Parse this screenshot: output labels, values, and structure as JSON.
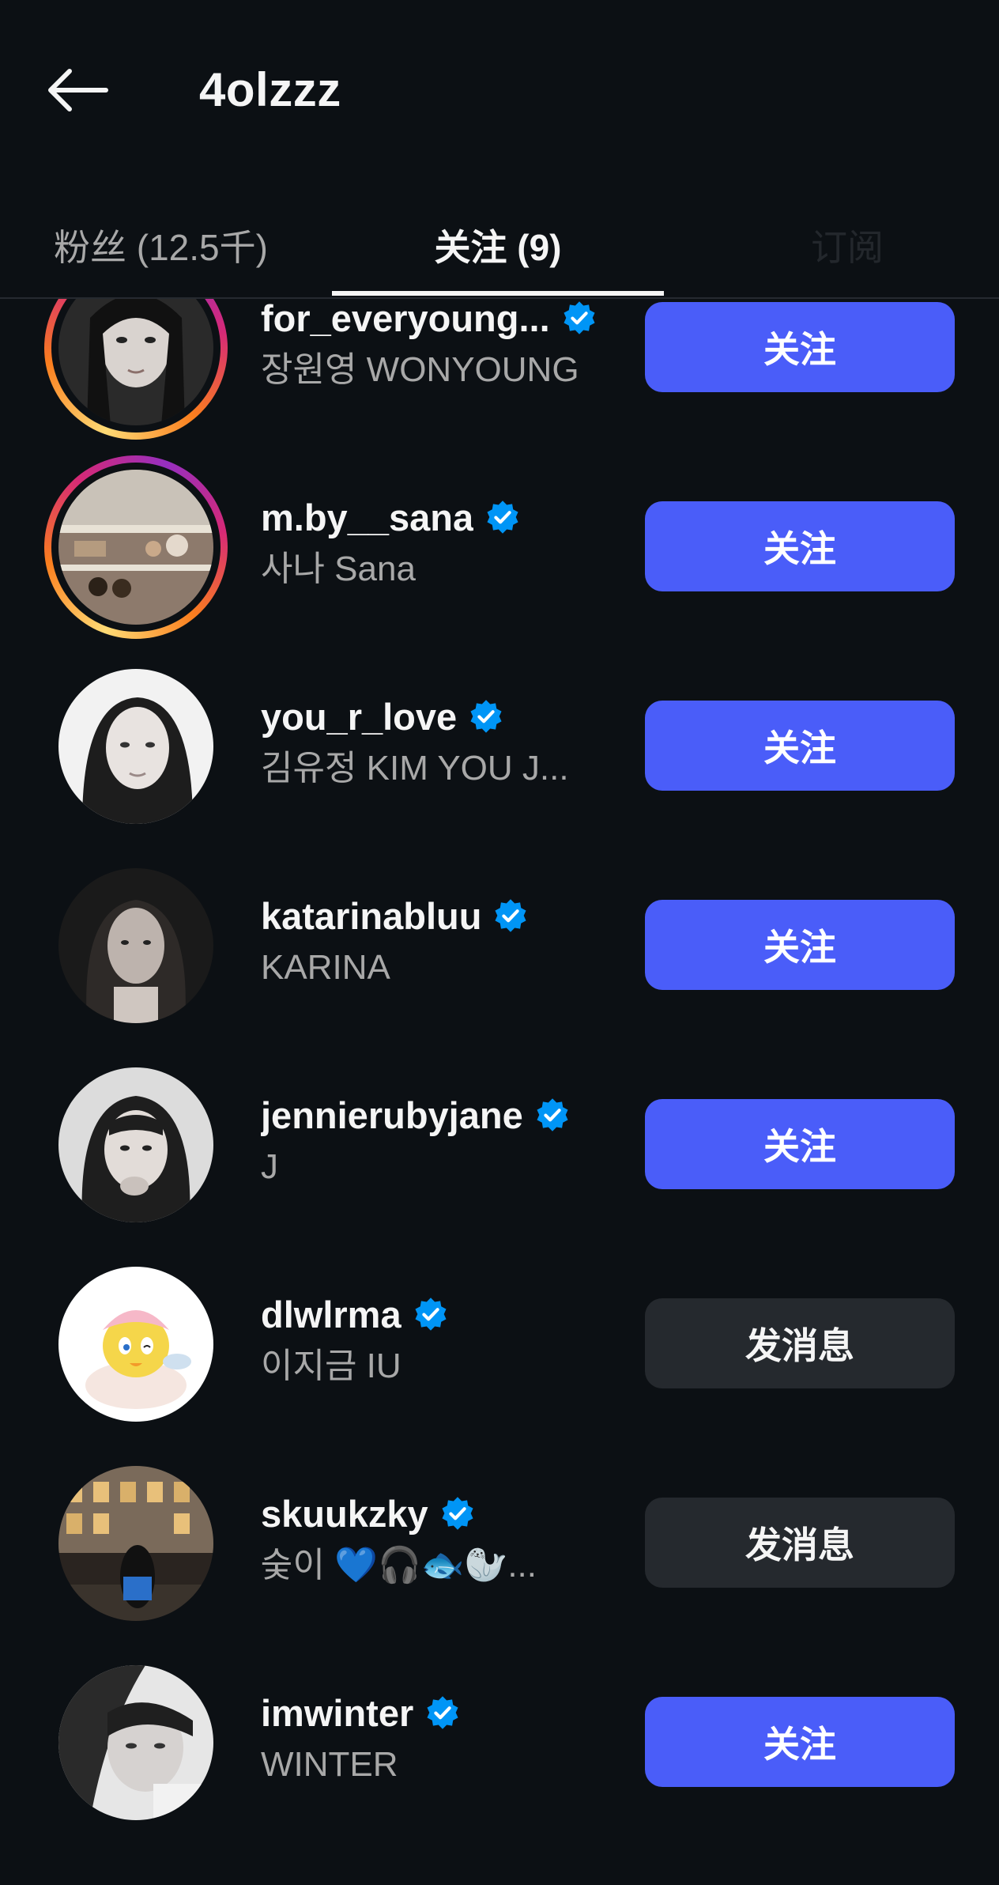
{
  "header": {
    "title": "4olzzz",
    "back_icon": "arrow-left-icon"
  },
  "tabs": [
    {
      "label": "粉丝 (12.5千)"
    },
    {
      "label": "关注 (9)"
    },
    {
      "label": "订阅"
    }
  ],
  "users": [
    {
      "username": "for_everyoung...",
      "full_name": "장원영 WONYOUNG",
      "verified": true,
      "ring": true,
      "action": "关注"
    },
    {
      "username": "m.by__sana",
      "full_name": "사나 Sana",
      "verified": true,
      "ring": true,
      "action": "关注"
    },
    {
      "username": "you_r_love",
      "full_name": "김유정  KIM YOU J...",
      "verified": true,
      "ring": false,
      "action": "关注"
    },
    {
      "username": "katarinabluu",
      "full_name": "KARINA",
      "verified": true,
      "ring": false,
      "action": "关注"
    },
    {
      "username": "jennierubyjane",
      "full_name": "J",
      "verified": true,
      "ring": false,
      "action": "关注"
    },
    {
      "username": "dlwlrma",
      "full_name": "이지금 IU",
      "verified": true,
      "ring": false,
      "action": "发消息"
    },
    {
      "username": "skuukzky",
      "full_name": "숮이  💙🎧🐟🦭...",
      "verified": true,
      "ring": false,
      "action": "发消息"
    },
    {
      "username": "imwinter",
      "full_name": "WINTER",
      "verified": true,
      "ring": false,
      "action": "关注"
    }
  ],
  "colors": {
    "background": "#0c1014",
    "follow_button": "#4a5df9",
    "message_button": "#25292e",
    "verified_badge": "#0095f6"
  }
}
